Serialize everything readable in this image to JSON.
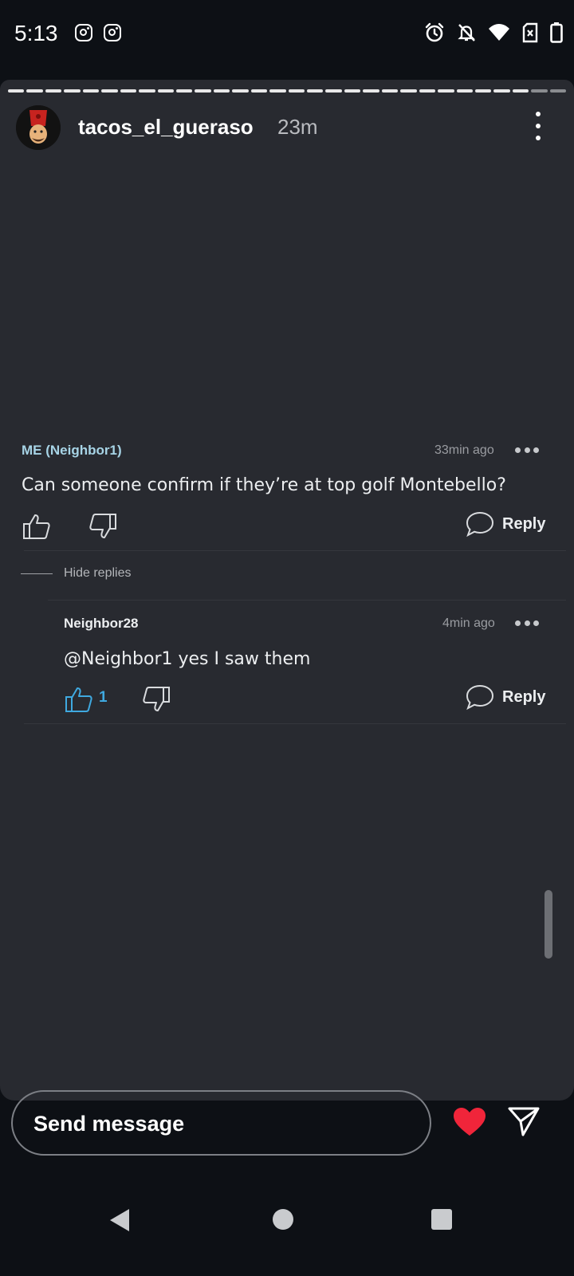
{
  "status_bar": {
    "time": "5:13",
    "left_icons": [
      "instagram-icon",
      "instagram-icon"
    ],
    "right_icons": [
      "alarm-icon",
      "notifications-off-icon",
      "wifi-icon",
      "no-sim-icon",
      "battery-icon"
    ]
  },
  "story": {
    "progress_segments_total": 30,
    "progress_segments_viewed": 28,
    "username": "tacos_el_gueraso",
    "time_ago": "23m",
    "menu_icon": "kebab-menu-icon"
  },
  "comments": [
    {
      "author": "ME (Neighbor1)",
      "author_color": "#a7d4e6",
      "time_ago": "33min ago",
      "text": "Can someone confirm if they’re at top golf Montebello?",
      "likes": "",
      "liked": false,
      "reply_label": "Reply"
    },
    {
      "author": "Neighbor28",
      "author_color": "#eceef0",
      "time_ago": "4min ago",
      "text": "@Neighbor1 yes I saw them",
      "likes": "1",
      "liked": true,
      "reply_label": "Reply"
    }
  ],
  "hide_replies_label": "Hide replies",
  "message_bar": {
    "placeholder": "Send message",
    "heart_color": "#f0253a"
  },
  "nav_bar": {
    "icons": [
      "back-icon",
      "home-icon",
      "recents-icon"
    ]
  }
}
